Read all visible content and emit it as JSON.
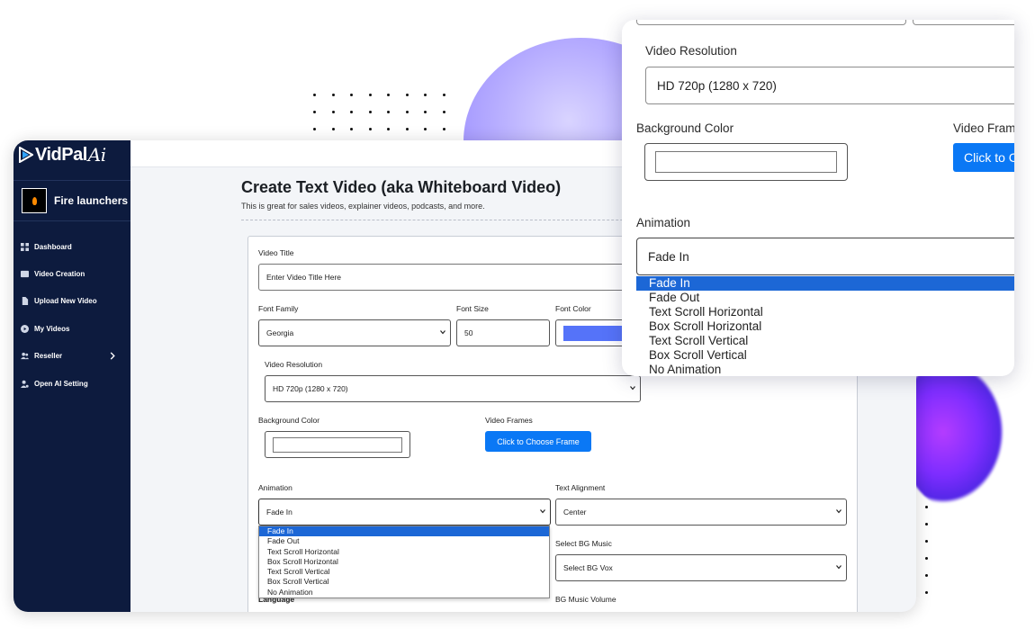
{
  "brand": {
    "name": "VidPal",
    "suffix": "Ai"
  },
  "profile": {
    "name": "Fire launchers"
  },
  "sidebar": {
    "items": [
      {
        "label": "Dashboard",
        "icon": "dashboard-icon"
      },
      {
        "label": "Video Creation",
        "icon": "video-icon"
      },
      {
        "label": "Upload New Video",
        "icon": "file-icon"
      },
      {
        "label": "My Videos",
        "icon": "play-circle-icon"
      },
      {
        "label": "Reseller",
        "icon": "users-icon"
      },
      {
        "label": "Open AI Setting",
        "icon": "user-gear-icon"
      }
    ]
  },
  "page": {
    "title": "Create Text Video (aka Whiteboard Video)",
    "subtitle": "This is great for sales videos, explainer videos, podcasts, and more."
  },
  "form": {
    "video_title_label": "Video Title",
    "video_title_placeholder": "Enter Video Title Here",
    "font_family_label": "Font Family",
    "font_family_value": "Georgia",
    "font_size_label": "Font Size",
    "font_size_value": "50",
    "font_color_label": "Font Color",
    "font_color_value": "#5573f9",
    "video_resolution_label": "Video Resolution",
    "video_resolution_value": "HD 720p (1280 x 720)",
    "background_color_label": "Background Color",
    "video_frames_label": "Video Frames",
    "choose_frame_button": "Click to Choose Frame",
    "animation_label": "Animation",
    "animation_value": "Fade In",
    "animation_options": [
      "Fade In",
      "Fade Out",
      "Text Scroll Horizontal",
      "Box Scroll Horizontal",
      "Text Scroll Vertical",
      "Box Scroll Vertical",
      "No Animation"
    ],
    "text_alignment_label": "Text Alignment",
    "text_alignment_value": "Center",
    "bg_music_label": "Select BG Music",
    "bg_music_value": "Select BG Vox",
    "language_label": "Language",
    "bg_music_volume_label": "BG Music Volume"
  },
  "zoom": {
    "video_resolution_label": "Video Resolution",
    "video_resolution_value": "HD 720p (1280 x 720)",
    "background_color_label": "Background Color",
    "video_frames_label": "Video Frame",
    "choose_frame_button": "Click to C",
    "animation_label": "Animation",
    "animation_value": "Fade In"
  },
  "colors": {
    "sidebar": "#0d1b3e",
    "accent": "#0a78f5",
    "selected": "#1c67d6"
  }
}
